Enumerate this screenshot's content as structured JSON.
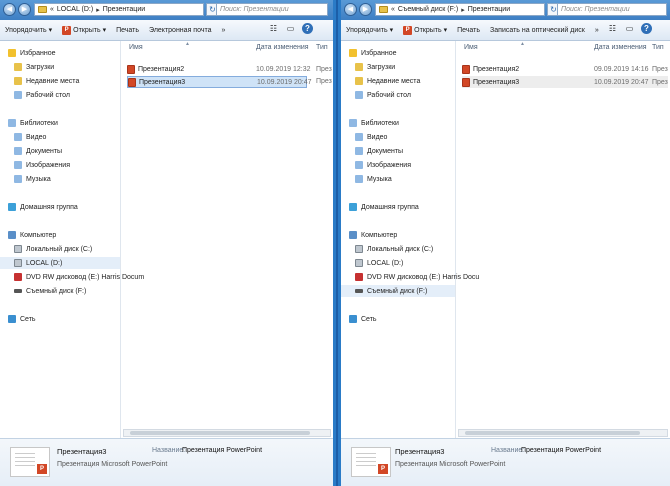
{
  "left": {
    "address": {
      "prefix": "«",
      "drive": "LOCAL (D:)",
      "folder": "Презентации"
    },
    "search_placeholder": "Поиск: Презентации",
    "toolbar": {
      "organize": "Упорядочить",
      "open": "Открыть",
      "print": "Печать",
      "email": "Электронная почта",
      "more": "»"
    },
    "nav": {
      "favorites": "Избранное",
      "downloads": "Загрузки",
      "recent": "Недавние места",
      "desktop": "Рабочий стол",
      "libraries": "Библиотеки",
      "video": "Видео",
      "documents": "Документы",
      "images": "Изображения",
      "music": "Музыка",
      "homegroup": "Домашняя группа",
      "computer": "Компьютер",
      "local_c": "Локальный диск (C:)",
      "local_d": "LOCAL (D:)",
      "dvd": "DVD RW дисковод (E:) Harris Docum",
      "removable": "Съемный диск (F:)",
      "network": "Сеть"
    },
    "columns": {
      "name": "Имя",
      "date": "Дата изменения",
      "type": "Тип"
    },
    "files": [
      {
        "name": "Презентация2",
        "date": "10.09.2019 12:32",
        "type": "През"
      },
      {
        "name": "Презентация3",
        "date": "10.09.2019 20:47",
        "type": "През"
      }
    ],
    "details": {
      "name": "Презентация3",
      "type": "Презентация Microsoft PowerPoint",
      "label": "Название:",
      "value": "Презентация PowerPoint"
    }
  },
  "right": {
    "address": {
      "prefix": "«",
      "drive": "Съемный диск (F:)",
      "folder": "Презентации"
    },
    "search_placeholder": "Поиск: Презентации",
    "toolbar": {
      "organize": "Упорядочить",
      "open": "Открыть",
      "print": "Печать",
      "burn": "Записать на оптический диск",
      "more": "»"
    },
    "nav": {
      "favorites": "Избранное",
      "downloads": "Загрузки",
      "recent": "Недавние места",
      "desktop": "Рабочий стол",
      "libraries": "Библиотеки",
      "video": "Видео",
      "documents": "Документы",
      "images": "Изображения",
      "music": "Музыка",
      "homegroup": "Домашняя группа",
      "computer": "Компьютер",
      "local_c": "Локальный диск (C:)",
      "local_d": "LOCAL (D:)",
      "dvd": "DVD RW дисковод (E:) Harris Docu",
      "removable": "Съемный диск (F:)",
      "network": "Сеть"
    },
    "columns": {
      "name": "Имя",
      "date": "Дата изменения",
      "type": "Тип"
    },
    "files": [
      {
        "name": "Презентация2",
        "date": "09.09.2019 14:16",
        "type": "През"
      },
      {
        "name": "Презентация3",
        "date": "10.09.2019 20:47",
        "type": "През"
      }
    ],
    "details": {
      "name": "Презентация3",
      "type": "Презентация Microsoft PowerPoint",
      "label": "Название:",
      "value": "Презентация PowerPoint"
    }
  }
}
